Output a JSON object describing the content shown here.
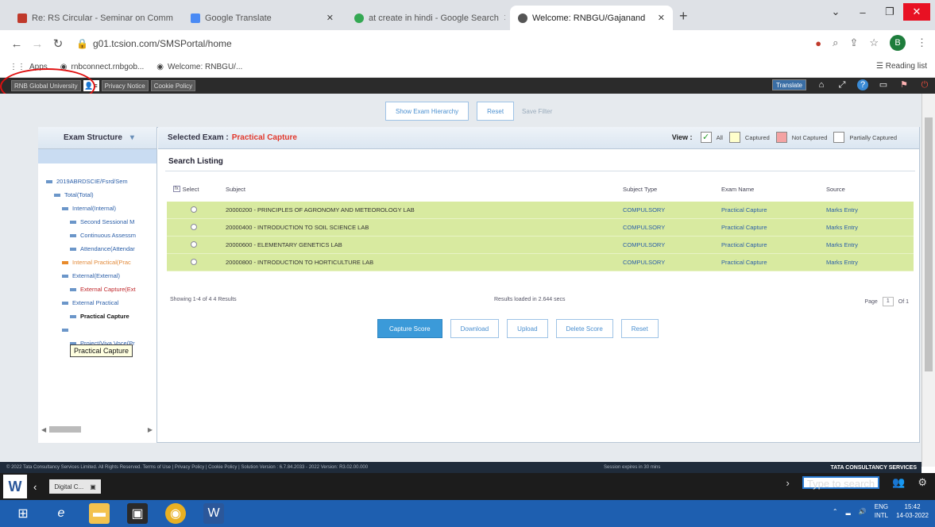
{
  "browser": {
    "tabs": [
      {
        "label": "Re: RS Circular - Seminar on Comm",
        "color": "#c0392b"
      },
      {
        "label": "Google Translate",
        "color": "#4a8af4"
      },
      {
        "label": "at create in hindi - Google Search",
        "color": "#34a853"
      },
      {
        "label": "Welcome: RNBGU/Gajanand",
        "color": "#555555"
      }
    ],
    "url": "g01.tcsion.com/SMSPortal/home",
    "bookmarks": [
      "Apps",
      "rnbconnect.rnbgob...",
      "Welcome: RNBGU/..."
    ],
    "reading_list": "Reading list",
    "profile_initial": "B"
  },
  "app_bar": {
    "university": "RNB Global University",
    "privacy": "Privacy Notice",
    "cookie": "Cookie Policy",
    "language": "Translate"
  },
  "toolbar": {
    "show_hierarchy": "Show Exam Hierarchy",
    "reset": "Reset",
    "save_filter": "Save Filter"
  },
  "left_panel": {
    "title": "Exam Structure",
    "tree": [
      {
        "label": "2019ABRDSCIE/Fsrd/Sem",
        "style": "normal",
        "indent": 0
      },
      {
        "label": "Total(Total)",
        "style": "normal",
        "indent": 1
      },
      {
        "label": "Internal(Internal)",
        "style": "normal",
        "indent": 2
      },
      {
        "label": "Second Sessional M",
        "style": "normal",
        "indent": 3
      },
      {
        "label": "Continuous Assessm",
        "style": "normal",
        "indent": 3
      },
      {
        "label": "Attendance(Attendar",
        "style": "normal",
        "indent": 3
      },
      {
        "label": "Internal Practical(Prac",
        "style": "orange",
        "indent": 2
      },
      {
        "label": "External(External)",
        "style": "normal",
        "indent": 2
      },
      {
        "label": "External Capture(Ext",
        "style": "red",
        "indent": 3
      },
      {
        "label": "External Practical",
        "style": "normal",
        "indent": 2
      },
      {
        "label": "Practical Capture",
        "style": "bold",
        "indent": 3
      },
      {
        "label": "",
        "style": "normal",
        "indent": 2
      },
      {
        "label": "Project/Viva Voce(Pr",
        "style": "normal",
        "indent": 3
      }
    ],
    "tooltip": "Practical Capture"
  },
  "right_panel": {
    "selected_label": "Selected Exam :",
    "selected_value": "Practical Capture",
    "view_label": "View :",
    "legend": [
      {
        "label": "All",
        "color": "#ffffff",
        "checked": "✓"
      },
      {
        "label": "Captured",
        "color": "#ffffcc",
        "checked": ""
      },
      {
        "label": "Not Captured",
        "color": "#f4a3a3",
        "checked": ""
      },
      {
        "label": "Partially Captured",
        "color": "#ffffff",
        "checked": ""
      }
    ],
    "search_listing": "Search Listing",
    "columns": {
      "select": "Select",
      "fx": "fx",
      "subject": "Subject",
      "type": "Subject Type",
      "exam": "Exam Name",
      "source": "Source"
    },
    "rows": [
      {
        "subject": "20000200 - PRINCIPLES OF AGRONOMY AND METEOROLOGY LAB",
        "type": "COMPULSORY",
        "exam": "Practical Capture",
        "source": "Marks Entry"
      },
      {
        "subject": "20000400 - INTRODUCTION TO SOIL SCIENCE LAB",
        "type": "COMPULSORY",
        "exam": "Practical Capture",
        "source": "Marks Entry"
      },
      {
        "subject": "20000600 - ELEMENTARY GENETICS LAB",
        "type": "COMPULSORY",
        "exam": "Practical Capture",
        "source": "Marks Entry"
      },
      {
        "subject": "20000800 - INTRODUCTION TO HORTICULTURE LAB",
        "type": "COMPULSORY",
        "exam": "Practical Capture",
        "source": "Marks Entry"
      }
    ],
    "showing": "Showing 1-4 of 4 4 Results",
    "fetched": "Results loaded in 2.644 secs",
    "page_label": "Page",
    "page_current": "1",
    "page_of": "Of 1",
    "actions": {
      "capture": "Capture Score",
      "download": "Download",
      "upload": "Upload",
      "delete": "Delete Score",
      "reset": "Reset"
    }
  },
  "footer": {
    "copyright": "© 2022 Tata Consultancy Services Limited. All Rights Reserved.   Terms of Use | Privacy Policy | Cookie Policy | Solution Version : 6.7.84.2033 - 2022   Version: R3.02.00.000",
    "session": "Session expires in 30 mins",
    "brand": "TATA CONSULTANCY SERVICES"
  },
  "word": {
    "logo": "W",
    "doc": "Digital C...",
    "search": "Type to search"
  },
  "taskbar": {
    "lang": "ENG",
    "lang_sub": "INTL",
    "time": "15:42",
    "date": "14-03-2022"
  }
}
